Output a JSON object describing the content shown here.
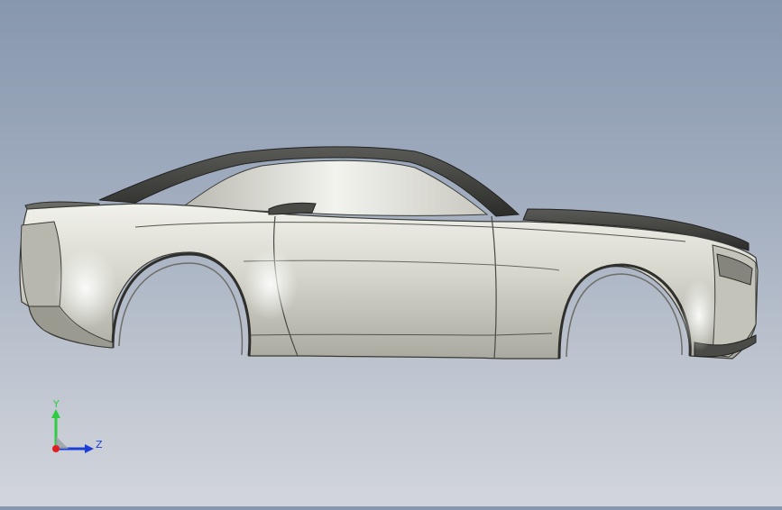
{
  "viewport": {
    "model": "car-body-shell",
    "background_top": "#8797ad",
    "background_bottom": "#d2d5dc",
    "body_color": "#d8d8d0",
    "edge_color": "#3a3a36"
  },
  "triad": {
    "y_label": "Y",
    "z_label": "Z",
    "y_color": "#2ecc40",
    "z_color": "#1b3fd6",
    "x_color": "#e02020"
  }
}
